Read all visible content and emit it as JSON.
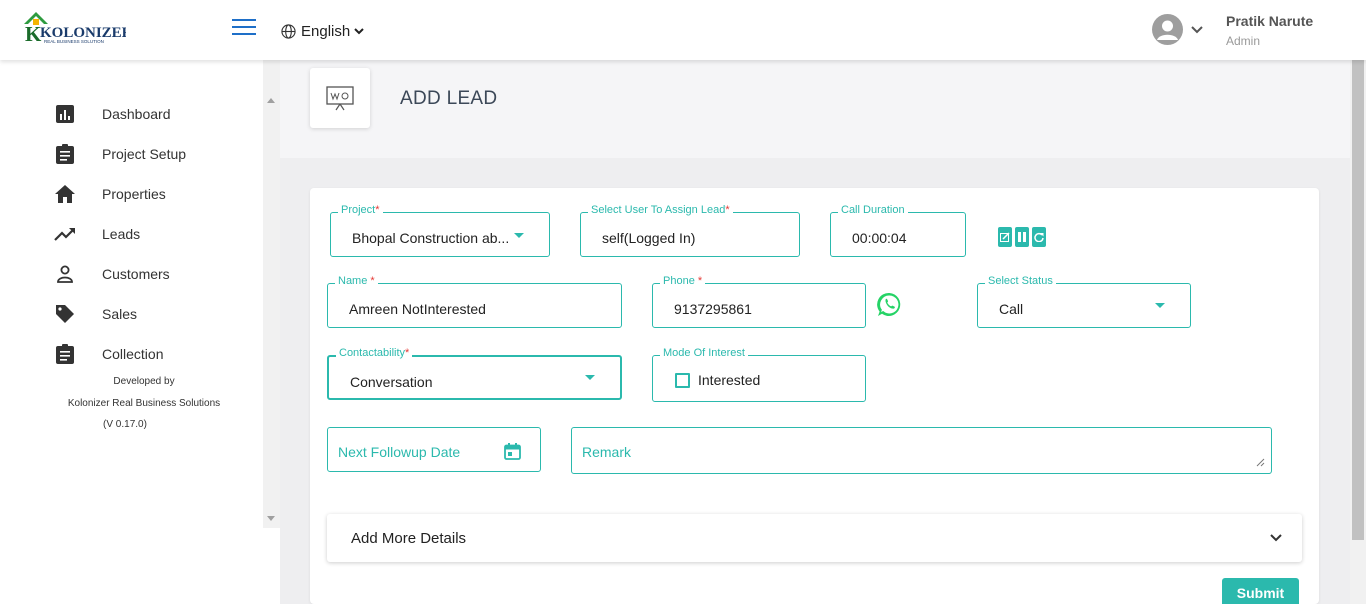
{
  "app": {
    "logo_text": "KOLONIZER",
    "logo_tagline": "REAL BUSINESS SOLUTION",
    "language": "English"
  },
  "user": {
    "name": "Pratik Narute",
    "role": "Admin"
  },
  "sidebar": {
    "items": [
      {
        "label": "Dashboard",
        "icon": "bar-chart-icon"
      },
      {
        "label": "Project Setup",
        "icon": "clipboard-icon"
      },
      {
        "label": "Properties",
        "icon": "home-icon"
      },
      {
        "label": "Leads",
        "icon": "trending-up-icon"
      },
      {
        "label": "Customers",
        "icon": "person-icon"
      },
      {
        "label": "Sales",
        "icon": "tag-icon"
      },
      {
        "label": "Collection",
        "icon": "clipboard-icon"
      }
    ],
    "developed_by": "Developed by",
    "company": "Kolonizer Real Business Solutions",
    "version": "(V 0.17.0)"
  },
  "page": {
    "title": "ADD LEAD"
  },
  "form": {
    "project": {
      "label": "Project",
      "value": "Bhopal Construction ab..."
    },
    "assign_user": {
      "label": "Select User To Assign Lead",
      "value": "self(Logged In)"
    },
    "call_duration": {
      "label": "Call Duration",
      "value": "00:00:04"
    },
    "name": {
      "label": "Name",
      "value": "Amreen NotInterested"
    },
    "phone": {
      "label": "Phone",
      "value": "9137295861"
    },
    "status": {
      "label": "Select Status",
      "value": "Call"
    },
    "contactability": {
      "label": "Contactability",
      "value": "Conversation"
    },
    "mode_of_interest": {
      "label": "Mode Of Interest",
      "option": "Interested",
      "checked": false
    },
    "next_followup": {
      "placeholder": "Next Followup Date"
    },
    "remark": {
      "placeholder": "Remark"
    },
    "add_more": "Add More Details",
    "submit": "Submit"
  },
  "colors": {
    "accent": "#2bb9ad",
    "required": "#e53935",
    "nav_blue": "#1e6fc8",
    "whatsapp": "#25d366"
  }
}
